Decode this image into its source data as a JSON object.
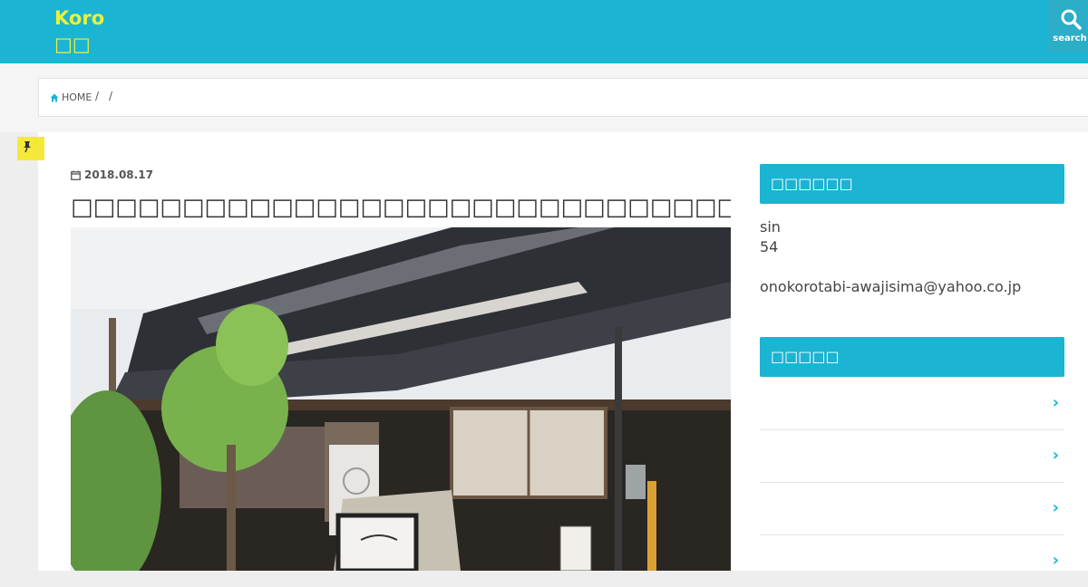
{
  "header": {
    "logo_line1": "Koro",
    "logo_line2": "□□",
    "search_label": "search"
  },
  "breadcrumb": {
    "home": "HOME",
    "sep": "/"
  },
  "post": {
    "date": "2018.08.17",
    "title": "□□□□□□□□□□□□□□□□□□□□□□□□□□□□□□□□□□□"
  },
  "sidebar": {
    "widget1_title": "□□□□□□",
    "profile_name": "sin",
    "profile_age": "54",
    "profile_email": "onokorotabi-awajisima@yahoo.co.jp",
    "widget2_title": "□□□□□",
    "list_items": [
      "",
      "",
      "",
      ""
    ]
  },
  "colors": {
    "accent": "#1bb4d3",
    "logo": "#eef03a",
    "pin": "#f4e93b"
  }
}
